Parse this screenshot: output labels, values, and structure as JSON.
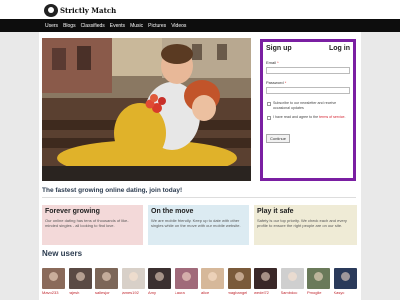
{
  "site": {
    "logo_text": "Strictly Match"
  },
  "nav": [
    "Users",
    "Blogs",
    "Classifieds",
    "Events",
    "Music",
    "Pictures",
    "Videos"
  ],
  "signup": {
    "title": "Sign up",
    "login_label": "Log in",
    "email_label": "Email",
    "password_label": "Password",
    "required_mark": "*",
    "newsletter_text": "Subscribe to our newsletter and receive occasional updates",
    "terms_prefix": "I have read and agree to the",
    "terms_link": "terms of service",
    "terms_suffix": ".",
    "continue_label": "Continue",
    "accent_color": "#7a1fa2"
  },
  "tagline": "The fastest growing online dating, join today!",
  "features": [
    {
      "title": "Forever growing",
      "text": "Our online dating has tens of thousands of like-minded singles - all looking to find love.",
      "color": "#f3d9d9"
    },
    {
      "title": "On the move",
      "text": "We are mobile friendly. Keep up to date with other singles while on the move with our mobile website.",
      "color": "#dcebf2"
    },
    {
      "title": "Play it safe",
      "text": "Safety is our top priority. We check each and every profile to ensure the right people are on our site.",
      "color": "#efebd6"
    }
  ],
  "new_users_title": "New users",
  "users": [
    {
      "name": "Mavo233",
      "color": "#8a6a5a"
    },
    {
      "name": "rajesh",
      "color": "#5a4a44"
    },
    {
      "name": "sallesjor",
      "color": "#7c6658"
    },
    {
      "name": "james192",
      "color": "#d8d0c8"
    },
    {
      "name": "Amy",
      "color": "#3b3030"
    },
    {
      "name": "Laura",
      "color": "#a06a7a"
    },
    {
      "name": "alice",
      "color": "#d6b89a"
    },
    {
      "name": "magbangel",
      "color": "#7a5a3a"
    },
    {
      "name": "wedel72",
      "color": "#3a2828"
    },
    {
      "name": "Sambdoc",
      "color": "#cfcfcf"
    },
    {
      "name": "Pmoglie",
      "color": "#6a7a5a"
    },
    {
      "name": "Kasyc",
      "color": "#2a3a5a"
    }
  ],
  "users_row2": [
    "#c9a68a",
    "#6a5040",
    "#4a4040",
    "#8a3a3a",
    "#b08a70",
    "#3a3a4a",
    "#7a6a5a",
    "#d0b0a0",
    "#5a4a3a",
    "#9a8070",
    "#2a2a2a",
    "#6a5a6a"
  ]
}
